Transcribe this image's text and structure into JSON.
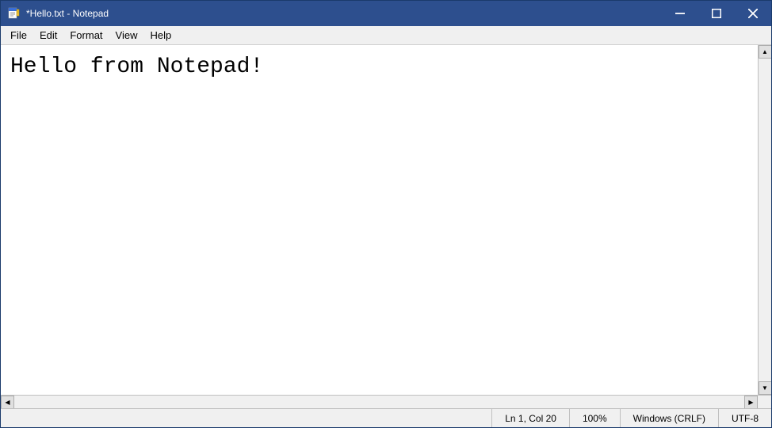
{
  "window": {
    "title": "*Hello.txt - Notepad",
    "icon": "notepad-icon"
  },
  "titlebar": {
    "minimize_label": "minimize",
    "maximize_label": "maximize",
    "close_label": "close"
  },
  "menubar": {
    "items": [
      {
        "label": "File",
        "id": "file"
      },
      {
        "label": "Edit",
        "id": "edit"
      },
      {
        "label": "Format",
        "id": "format"
      },
      {
        "label": "View",
        "id": "view"
      },
      {
        "label": "Help",
        "id": "help"
      }
    ]
  },
  "editor": {
    "content": "Hello from Notepad!"
  },
  "statusbar": {
    "position": "Ln 1, Col 20",
    "zoom": "100%",
    "line_ending": "Windows (CRLF)",
    "encoding": "UTF-8"
  }
}
